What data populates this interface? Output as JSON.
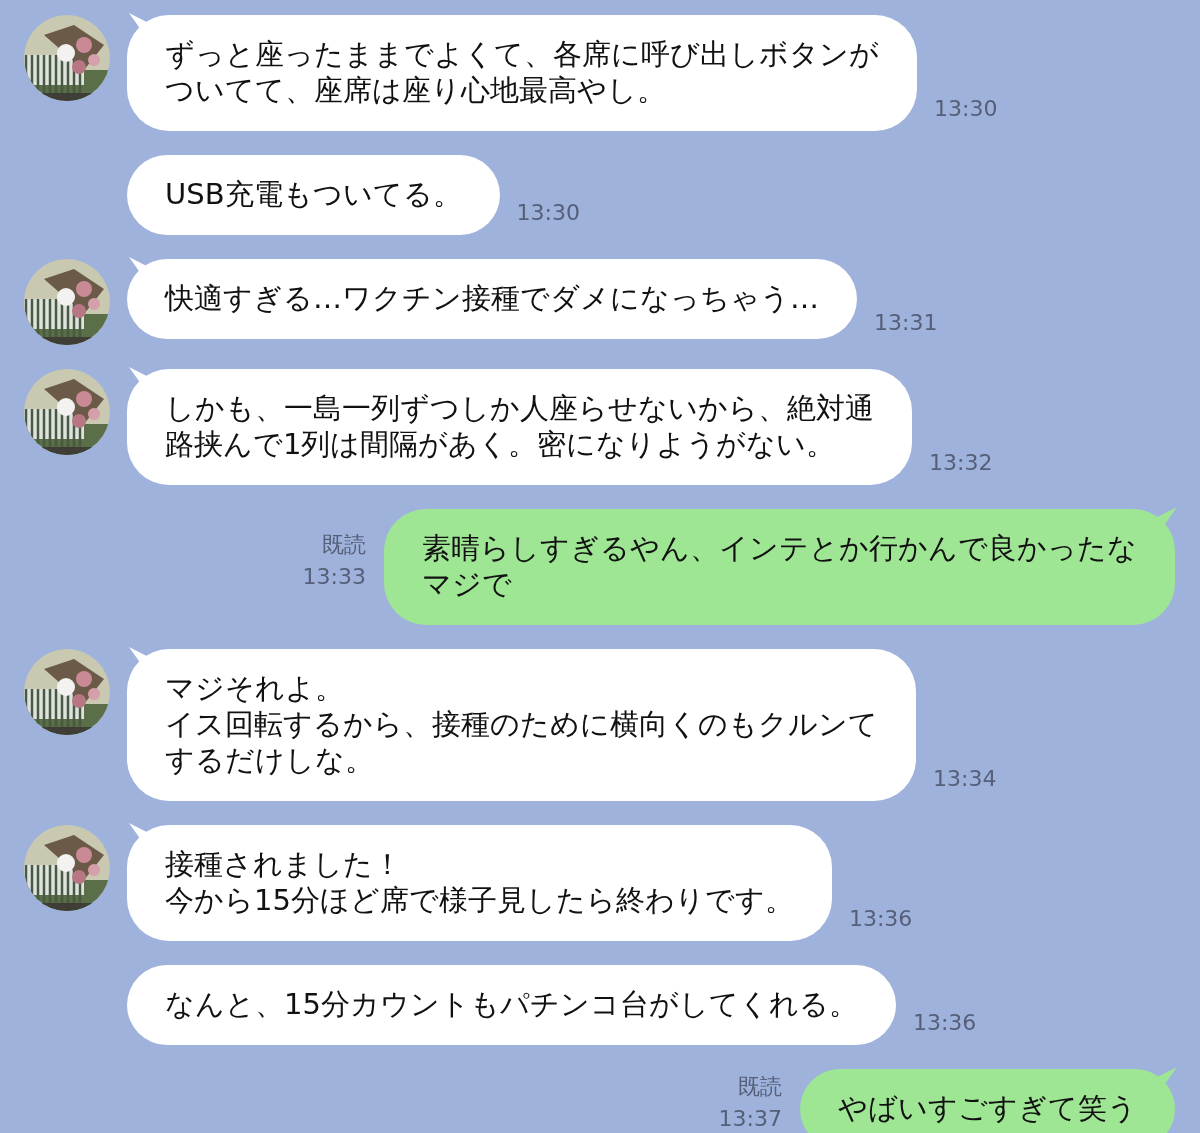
{
  "messages": [
    {
      "kind": "incoming",
      "show_avatar": true,
      "lines": [
        "ずっと座ったままでよくて、各席に呼び出しボタンが",
        "ついてて、座席は座り心地最高やし。"
      ],
      "time": "13:30"
    },
    {
      "kind": "incoming",
      "show_avatar": false,
      "lines": [
        "USB充電もついてる。"
      ],
      "time": "13:30"
    },
    {
      "kind": "incoming",
      "show_avatar": true,
      "lines": [
        "快適すぎる…ワクチン接種でダメになっちゃう…"
      ],
      "time": "13:31"
    },
    {
      "kind": "incoming",
      "show_avatar": true,
      "lines": [
        "しかも、一島一列ずつしか人座らせないから、絶対通",
        "路挟んで1列は間隔があく。密になりようがない。"
      ],
      "time": "13:32"
    },
    {
      "kind": "outgoing",
      "read": "既読",
      "lines": [
        "素晴らしすぎるやん、インテとか行かんで良かったな",
        "マジで"
      ],
      "time": "13:33"
    },
    {
      "kind": "incoming",
      "show_avatar": true,
      "lines": [
        "マジそれよ。",
        "イス回転するから、接種のために横向くのもクルンて",
        "するだけしな。"
      ],
      "time": "13:34"
    },
    {
      "kind": "incoming",
      "show_avatar": true,
      "lines": [
        "接種されました！",
        "今から15分ほど席で様子見したら終わりです。"
      ],
      "time": "13:36"
    },
    {
      "kind": "incoming",
      "show_avatar": false,
      "lines": [
        "なんと、15分カウントもパチンコ台がしてくれる。"
      ],
      "time": "13:36"
    },
    {
      "kind": "outgoing",
      "read": "既読",
      "lines": [
        "やばいすごすぎて笑う"
      ],
      "time": "13:37"
    }
  ]
}
